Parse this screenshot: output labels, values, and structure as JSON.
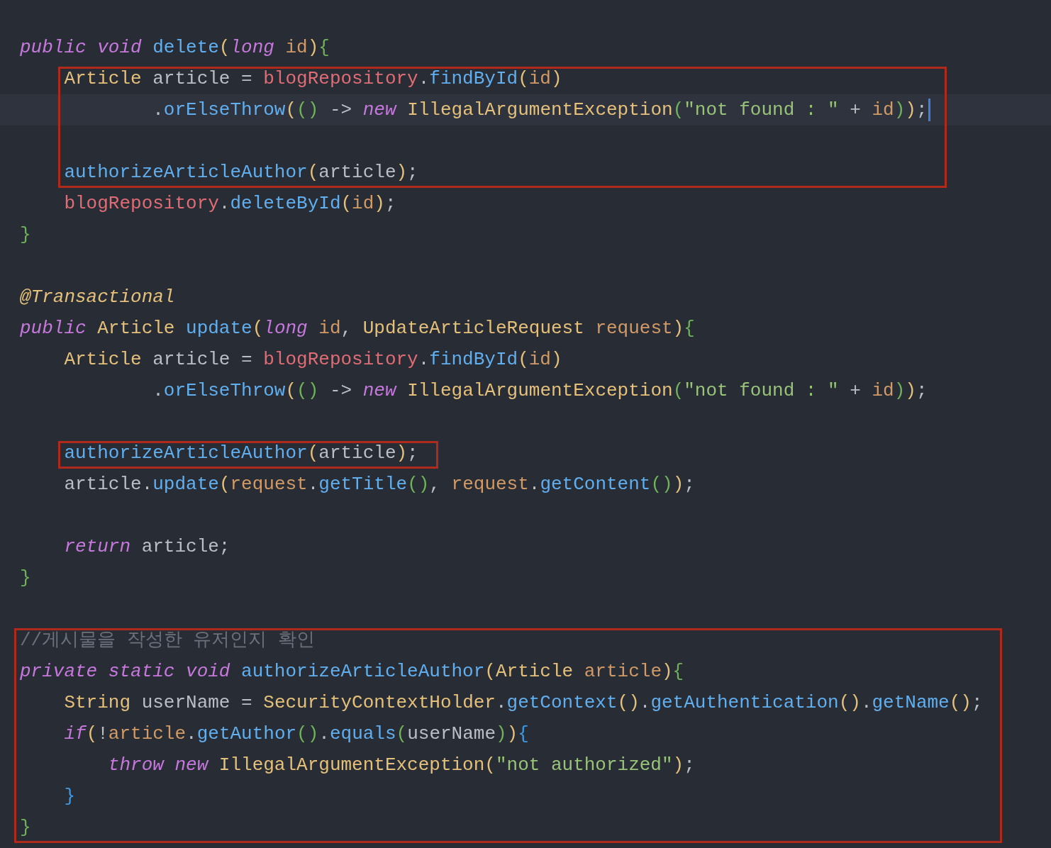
{
  "blocks": [
    {
      "lines": [
        {
          "kind": "code",
          "tokens": [
            {
              "text": "public void ",
              "kind": "kw"
            },
            {
              "text": "delete",
              "kind": "fn"
            },
            {
              "text": "(",
              "kind": "b1"
            },
            {
              "text": "long ",
              "kind": "kw"
            },
            {
              "text": "id",
              "kind": "param"
            },
            {
              "text": ")",
              "kind": "b1"
            },
            {
              "text": "{",
              "kind": "b2"
            }
          ]
        }
      ]
    },
    {
      "boxed": true,
      "lines": [
        {
          "kind": "code",
          "tokens": [
            {
              "text": "    Article ",
              "kind": "type"
            },
            {
              "text": "article = ",
              "kind": "var"
            },
            {
              "text": "blogRepository",
              "kind": "field"
            },
            {
              "text": ".",
              "kind": "op"
            },
            {
              "text": "findById",
              "kind": "fn"
            },
            {
              "text": "(",
              "kind": "b1"
            },
            {
              "text": "id",
              "kind": "param"
            },
            {
              "text": ")",
              "kind": "b1"
            }
          ]
        },
        {
          "kind": "code",
          "current": true,
          "tokens": [
            {
              "text": "            .",
              "kind": "op"
            },
            {
              "text": "orElseThrow",
              "kind": "fn"
            },
            {
              "text": "(",
              "kind": "b1"
            },
            {
              "text": "()",
              "kind": "b2"
            },
            {
              "text": " -> ",
              "kind": "op"
            },
            {
              "text": "new ",
              "kind": "kw"
            },
            {
              "text": "IllegalArgumentException",
              "kind": "type"
            },
            {
              "text": "(",
              "kind": "b2"
            },
            {
              "text": "\"not found : \"",
              "kind": "str"
            },
            {
              "text": " + ",
              "kind": "op"
            },
            {
              "text": "id",
              "kind": "param"
            },
            {
              "text": ")",
              "kind": "b2"
            },
            {
              "text": ")",
              "kind": "b1"
            },
            {
              "text": ";",
              "kind": "op"
            }
          ]
        },
        {
          "kind": "blank"
        },
        {
          "kind": "code",
          "tokens": [
            {
              "text": "    authorizeArticleAuthor",
              "kind": "fn"
            },
            {
              "text": "(",
              "kind": "b1"
            },
            {
              "text": "article",
              "kind": "var"
            },
            {
              "text": ")",
              "kind": "b1"
            },
            {
              "text": ";",
              "kind": "op"
            }
          ]
        }
      ]
    },
    {
      "lines": [
        {
          "kind": "code",
          "tokens": [
            {
              "text": "    blogRepository",
              "kind": "field"
            },
            {
              "text": ".",
              "kind": "op"
            },
            {
              "text": "deleteById",
              "kind": "fn"
            },
            {
              "text": "(",
              "kind": "b1"
            },
            {
              "text": "id",
              "kind": "param"
            },
            {
              "text": ")",
              "kind": "b1"
            },
            {
              "text": ";",
              "kind": "op"
            }
          ]
        },
        {
          "kind": "code",
          "tokens": [
            {
              "text": "}",
              "kind": "b2"
            }
          ]
        },
        {
          "kind": "blank"
        },
        {
          "kind": "code",
          "tokens": [
            {
              "text": "@Transactional",
              "kind": "annot"
            }
          ]
        },
        {
          "kind": "code",
          "tokens": [
            {
              "text": "public ",
              "kind": "kw"
            },
            {
              "text": "Article ",
              "kind": "type"
            },
            {
              "text": "update",
              "kind": "fn"
            },
            {
              "text": "(",
              "kind": "b1"
            },
            {
              "text": "long ",
              "kind": "kw"
            },
            {
              "text": "id",
              "kind": "param"
            },
            {
              "text": ", ",
              "kind": "op"
            },
            {
              "text": "UpdateArticleRequest ",
              "kind": "type"
            },
            {
              "text": "request",
              "kind": "param"
            },
            {
              "text": ")",
              "kind": "b1"
            },
            {
              "text": "{",
              "kind": "b2"
            }
          ]
        },
        {
          "kind": "code",
          "tokens": [
            {
              "text": "    Article ",
              "kind": "type"
            },
            {
              "text": "article = ",
              "kind": "var"
            },
            {
              "text": "blogRepository",
              "kind": "field"
            },
            {
              "text": ".",
              "kind": "op"
            },
            {
              "text": "findById",
              "kind": "fn"
            },
            {
              "text": "(",
              "kind": "b1"
            },
            {
              "text": "id",
              "kind": "param"
            },
            {
              "text": ")",
              "kind": "b1"
            }
          ]
        },
        {
          "kind": "code",
          "tokens": [
            {
              "text": "            .",
              "kind": "op"
            },
            {
              "text": "orElseThrow",
              "kind": "fn"
            },
            {
              "text": "(",
              "kind": "b1"
            },
            {
              "text": "()",
              "kind": "b2"
            },
            {
              "text": " -> ",
              "kind": "op"
            },
            {
              "text": "new ",
              "kind": "kw"
            },
            {
              "text": "IllegalArgumentException",
              "kind": "type"
            },
            {
              "text": "(",
              "kind": "b2"
            },
            {
              "text": "\"not found : \"",
              "kind": "str"
            },
            {
              "text": " + ",
              "kind": "op"
            },
            {
              "text": "id",
              "kind": "param"
            },
            {
              "text": ")",
              "kind": "b2"
            },
            {
              "text": ")",
              "kind": "b1"
            },
            {
              "text": ";",
              "kind": "op"
            }
          ]
        },
        {
          "kind": "blank"
        }
      ]
    },
    {
      "boxed": true,
      "lines": [
        {
          "kind": "code",
          "tokens": [
            {
              "text": "    authorizeArticleAuthor",
              "kind": "fn"
            },
            {
              "text": "(",
              "kind": "b1"
            },
            {
              "text": "article",
              "kind": "var"
            },
            {
              "text": ")",
              "kind": "b1"
            },
            {
              "text": ";",
              "kind": "op"
            }
          ]
        }
      ]
    },
    {
      "lines": [
        {
          "kind": "code",
          "tokens": [
            {
              "text": "    article",
              "kind": "var"
            },
            {
              "text": ".",
              "kind": "op"
            },
            {
              "text": "update",
              "kind": "fn"
            },
            {
              "text": "(",
              "kind": "b1"
            },
            {
              "text": "request",
              "kind": "param"
            },
            {
              "text": ".",
              "kind": "op"
            },
            {
              "text": "getTitle",
              "kind": "fn"
            },
            {
              "text": "()",
              "kind": "b2"
            },
            {
              "text": ", ",
              "kind": "op"
            },
            {
              "text": "request",
              "kind": "param"
            },
            {
              "text": ".",
              "kind": "op"
            },
            {
              "text": "getContent",
              "kind": "fn"
            },
            {
              "text": "()",
              "kind": "b2"
            },
            {
              "text": ")",
              "kind": "b1"
            },
            {
              "text": ";",
              "kind": "op"
            }
          ]
        },
        {
          "kind": "blank"
        },
        {
          "kind": "code",
          "tokens": [
            {
              "text": "    return ",
              "kind": "kw"
            },
            {
              "text": "article",
              "kind": "var"
            },
            {
              "text": ";",
              "kind": "op"
            }
          ]
        },
        {
          "kind": "code",
          "tokens": [
            {
              "text": "}",
              "kind": "b2"
            }
          ]
        },
        {
          "kind": "blank"
        }
      ]
    },
    {
      "boxed": true,
      "lines": [
        {
          "kind": "code",
          "tokens": [
            {
              "text": "//게시물을 작성한 유저인지 확인",
              "kind": "comment"
            }
          ]
        },
        {
          "kind": "code",
          "tokens": [
            {
              "text": "private static void ",
              "kind": "kw"
            },
            {
              "text": "authorizeArticleAuthor",
              "kind": "fn"
            },
            {
              "text": "(",
              "kind": "b1"
            },
            {
              "text": "Article ",
              "kind": "type"
            },
            {
              "text": "article",
              "kind": "param"
            },
            {
              "text": ")",
              "kind": "b1"
            },
            {
              "text": "{",
              "kind": "b2"
            }
          ]
        },
        {
          "kind": "code",
          "tokens": [
            {
              "text": "    String ",
              "kind": "type"
            },
            {
              "text": "userName = ",
              "kind": "var"
            },
            {
              "text": "SecurityContextHolder",
              "kind": "type"
            },
            {
              "text": ".",
              "kind": "op"
            },
            {
              "text": "getContext",
              "kind": "fn"
            },
            {
              "text": "()",
              "kind": "b1"
            },
            {
              "text": ".",
              "kind": "op"
            },
            {
              "text": "getAuthentication",
              "kind": "fn"
            },
            {
              "text": "()",
              "kind": "b1"
            },
            {
              "text": ".",
              "kind": "op"
            },
            {
              "text": "getName",
              "kind": "fn"
            },
            {
              "text": "()",
              "kind": "b1"
            },
            {
              "text": ";",
              "kind": "op"
            }
          ]
        },
        {
          "kind": "code",
          "tokens": [
            {
              "text": "    if",
              "kind": "kw"
            },
            {
              "text": "(",
              "kind": "b1"
            },
            {
              "text": "!",
              "kind": "op"
            },
            {
              "text": "article",
              "kind": "param"
            },
            {
              "text": ".",
              "kind": "op"
            },
            {
              "text": "getAuthor",
              "kind": "fn"
            },
            {
              "text": "()",
              "kind": "b2"
            },
            {
              "text": ".",
              "kind": "op"
            },
            {
              "text": "equals",
              "kind": "fn"
            },
            {
              "text": "(",
              "kind": "b2"
            },
            {
              "text": "userName",
              "kind": "var"
            },
            {
              "text": ")",
              "kind": "b2"
            },
            {
              "text": ")",
              "kind": "b1"
            },
            {
              "text": "{",
              "kind": "b3"
            }
          ]
        },
        {
          "kind": "code",
          "tokens": [
            {
              "text": "        throw new ",
              "kind": "kw"
            },
            {
              "text": "IllegalArgumentException",
              "kind": "type"
            },
            {
              "text": "(",
              "kind": "b1"
            },
            {
              "text": "\"not authorized\"",
              "kind": "str"
            },
            {
              "text": ")",
              "kind": "b1"
            },
            {
              "text": ";",
              "kind": "op"
            }
          ]
        },
        {
          "kind": "code",
          "tokens": [
            {
              "text": "    }",
              "kind": "b3"
            }
          ]
        },
        {
          "kind": "code",
          "tokens": [
            {
              "text": "}",
              "kind": "b2"
            }
          ]
        }
      ]
    }
  ]
}
